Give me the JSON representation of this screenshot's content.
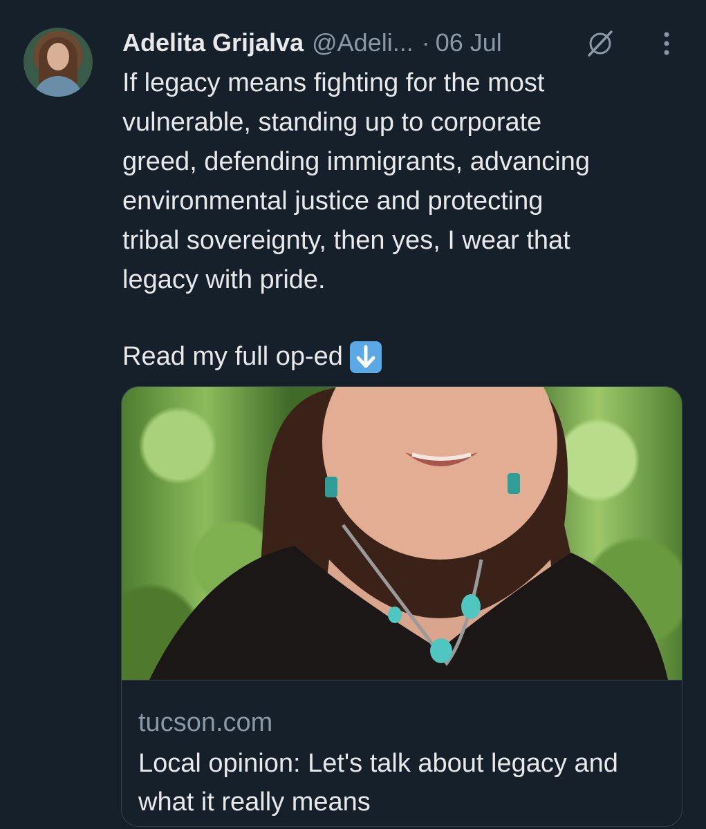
{
  "tweet": {
    "author_name": "Adelita Grijalva",
    "handle": "@Adeli...",
    "separator": "·",
    "date": "06 Jul",
    "body": "If legacy means fighting for the most\nvulnerable, standing up to corporate\ngreed, defending immigrants, advancing\nenvironmental justice and protecting\ntribal sovereignty, then yes, I wear that\nlegacy with pride.",
    "read_more": "Read my full op-ed",
    "icons": {
      "grok": "grok-icon",
      "more": "more-vertical-icon",
      "arrow": "down-arrow-emoji"
    }
  },
  "link_card": {
    "domain": "tucson.com",
    "title": "Local opinion: Let's talk about legacy and what it really means"
  },
  "colors": {
    "background": "#15202b",
    "primary_text": "#e7e9ea",
    "secondary_text": "#8b98a5",
    "border": "#38444d",
    "arrow_emoji": "#5aa9e6"
  }
}
